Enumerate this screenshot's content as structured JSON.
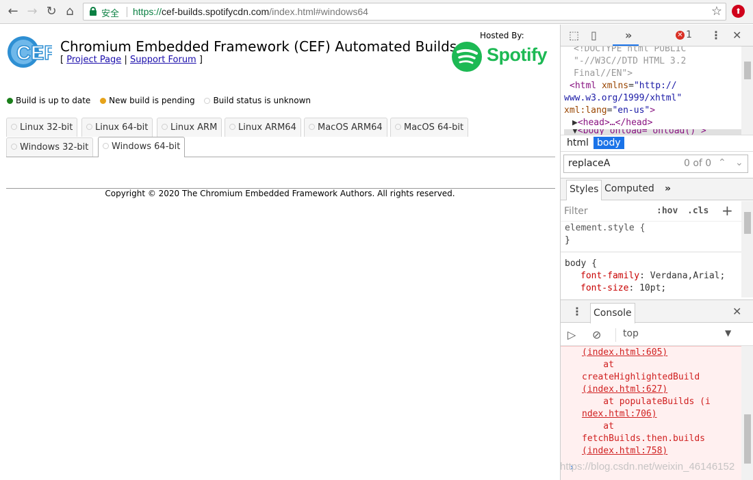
{
  "browser": {
    "secure_label": "安全",
    "url_scheme": "https://",
    "url_host": "cef-builds.spotifycdn.com",
    "url_path": "/index.html#windows64"
  },
  "page": {
    "logo_text": "CEF",
    "title": "Chromium Embedded Framework (CEF) Automated Builds",
    "link_open": "[",
    "link_project": "Project Page",
    "link_sep": "|",
    "link_forum": "Support Forum",
    "link_close": "]",
    "hosted_by": "Hosted By:",
    "spotify_name": "Spotify",
    "legend": {
      "up_to_date": "Build is up to date",
      "pending": "New build is pending",
      "unknown": "Build status is unknown"
    },
    "tabs": [
      "Linux 32-bit",
      "Linux 64-bit",
      "Linux ARM",
      "Linux ARM64",
      "MacOS ARM64",
      "MacOS 64-bit",
      "Windows 32-bit",
      "Windows 64-bit"
    ],
    "active_tab": "Windows 64-bit",
    "copyright": "Copyright © 2020 The Chromium Embedded Framework Authors. All rights reserved."
  },
  "devtools": {
    "error_count": "1",
    "dom": {
      "l1": "<!DOCTYPE html PUBLIC",
      "l2": "\"-//W3C//DTD HTML 3.2",
      "l3": "Final//EN\">",
      "html_tag": "html",
      "xmlns_attr": "xmlns",
      "xmlns_val1": "\"http://",
      "xmlns_val2": "www.w3.org/1999/xhtml\"",
      "lang_attr": "xml:lang",
      "lang_val": "\"en-us\"",
      "head": "<head>…</head>",
      "body_partial": "<body onload=\"onload()\">"
    },
    "crumbs": [
      "html",
      "body"
    ],
    "find_value": "replaceA",
    "find_count": "0 of 0",
    "styles_tabs": [
      "Styles",
      "Computed"
    ],
    "filter_placeholder": "Filter",
    "hov": ":hov",
    "cls": ".cls",
    "element_style": "element.style {",
    "close_brace": "}",
    "body_selector": "body {",
    "props": [
      {
        "name": "font-family",
        "value": "Verdana,Arial;"
      },
      {
        "name": "font-size",
        "value": "10pt;"
      }
    ],
    "drawer_tab": "Console",
    "context": "top",
    "console_lines": [
      {
        "text": "(index.html:605)",
        "link": true
      },
      {
        "text": "    at",
        "link": false
      },
      {
        "text": "createHighlightedBuild",
        "link": false
      },
      {
        "text": "(index.html:627)",
        "link": true
      },
      {
        "text": "    at populateBuilds (i",
        "link": false
      },
      {
        "text": "ndex.html:706)",
        "link": true
      },
      {
        "text": "    at",
        "link": false
      },
      {
        "text": "fetchBuilds.then.builds",
        "link": false
      },
      {
        "text": "(index.html:758)",
        "link": true
      }
    ],
    "prompt": "›"
  },
  "watermark": "https://blog.csdn.net/weixin_46146152",
  "colors": {
    "spotify_green": "#1db954",
    "secure_green": "#0b8043",
    "error_red": "#d02020",
    "devtools_blue": "#1a73e8"
  }
}
